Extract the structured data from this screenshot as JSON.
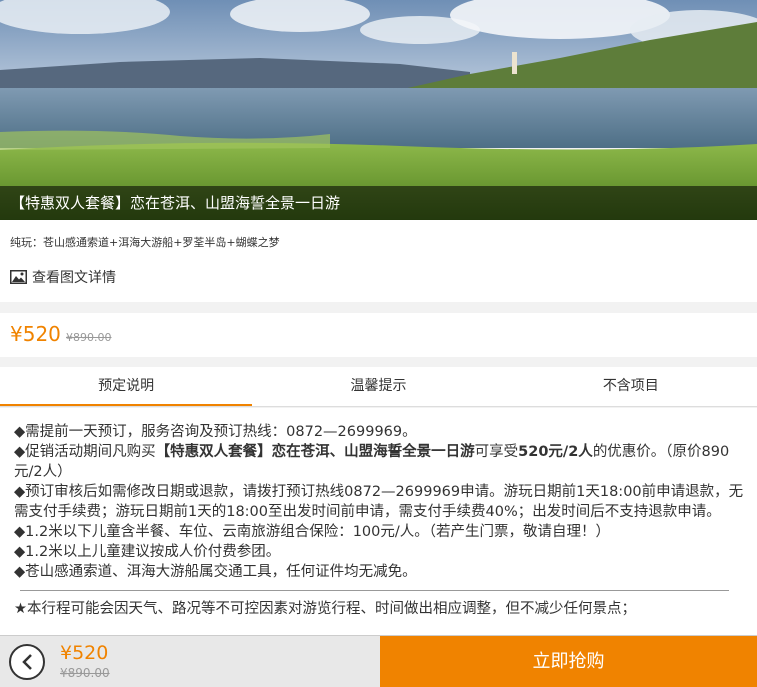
{
  "hero": {
    "image": "landscape-photo-lake-and-hills",
    "title": "【特惠双人套餐】恋在苍洱、山盟海誓全景一日游"
  },
  "info": {
    "route": "纯玩：苍山感通索道+洱海大游船+罗荃半岛+蝴蝶之梦",
    "detail_link": "查看图文详情",
    "detail_icon": "image-icon"
  },
  "price": {
    "current": "¥520",
    "original": "¥890.00"
  },
  "tabs": [
    {
      "label": "预定说明",
      "active": true
    },
    {
      "label": "温馨提示",
      "active": false
    },
    {
      "label": "不含项目",
      "active": false
    }
  ],
  "content": {
    "line1": "◆需提前一天预订，服务咨询及预订热线：0872—2699969。",
    "line2_pre": "◆促销活动期间凡购买",
    "line2_bold": "【特惠双人套餐】恋在苍洱、山盟海誓全景一日游",
    "line2_mid": "可享受",
    "line2_bold2": "520元/2人",
    "line2_post": "的优惠价。（原价890元/2人）",
    "line3": "◆预订审核后如需修改日期或退款，请拨打预订热线0872—2699969申请。游玩日期前1天18:00前申请退款，无需支付手续费；游玩日期前1天的18:00至出发时间前申请，需支付手续费40%；出发时间后不支持退款申请。",
    "line4": "◆1.2米以下儿童含半餐、车位、云南旅游组合保险：100元/人。（若产生门票，敬请自理！）",
    "line5": "◆1.2米以上儿童建议按成人价付费参团。",
    "line6": "◆苍山感通索道、洱海大游船属交通工具，任何证件均无减免。",
    "note": "★本行程可能会因天气、路况等不可控因素对游览行程、时间做出相应调整，但不减少任何景点；"
  },
  "bottom_bar": {
    "back_icon": "chevron-left-icon",
    "price_current": "¥520",
    "price_original": "¥890.00",
    "buy_label": "立即抢购"
  },
  "colors": {
    "accent": "#f08300",
    "caption_bg": "rgba(0,0,0,0.55)"
  }
}
